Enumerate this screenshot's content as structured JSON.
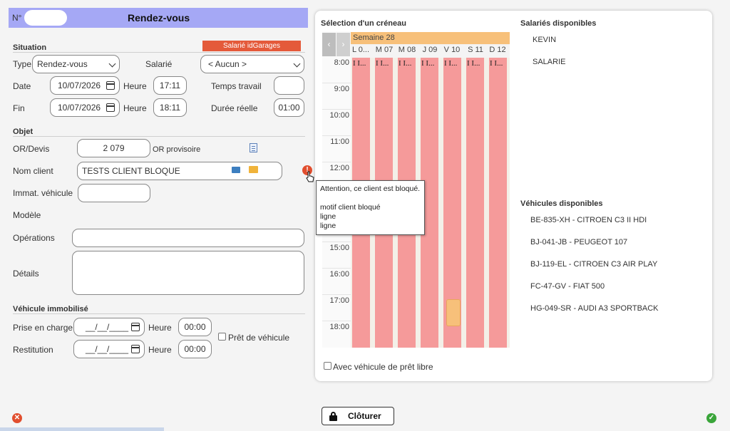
{
  "header": {
    "no_label": "N°",
    "title": "Rendez-vous",
    "header_color": "#a5a8f5"
  },
  "situation": {
    "section_title": "Situation",
    "badge": "Salarié idGarages",
    "badge_color": "#e45a3a",
    "type_label": "Type",
    "type_value": "Rendez-vous",
    "salarie_label": "Salarié",
    "salarie_value": "< Aucun >",
    "date_label": "Date",
    "date_value": "10/07/2026",
    "heure_label": "Heure",
    "date_time": "17:11",
    "temps_travail_label": "Temps travail",
    "temps_travail_value": "",
    "fin_label": "Fin",
    "fin_value": "10/07/2026",
    "fin_time": "18:11",
    "duree_label": "Durée réelle",
    "duree_value": "01:00"
  },
  "objet": {
    "section_title": "Objet",
    "or_label": "OR/Devis",
    "or_value": "2 079",
    "or_provisoire": "OR provisoire",
    "client_label": "Nom client",
    "client_value": "TESTS CLIENT BLOQUE",
    "immat_label": "Immat. véhicule",
    "immat_value": "",
    "modele_label": "Modèle",
    "operations_label": "Opérations",
    "details_label": "Détails"
  },
  "tooltip": {
    "line1": "Attention, ce client est bloqué.",
    "line2": "motif client bloqué",
    "line3": "ligne",
    "line4": "ligne"
  },
  "immobilise": {
    "section_title": "Véhicule immobilisé",
    "prise_label": "Prise en charge",
    "prise_date": "__/__/____",
    "heure_label": "Heure",
    "prise_time": "00:00",
    "pret_label": "Prêt de véhicule",
    "restitution_label": "Restitution",
    "restitution_date": "__/__/____",
    "restitution_time": "00:00"
  },
  "calendar": {
    "title": "Sélection d'un créneau",
    "week": "Semaine 28",
    "week_color": "#f7c07a",
    "day_color": "#f59a9a",
    "slot_color": "#f7c07a",
    "slot_text": "I I...",
    "days": [
      "L 0...",
      "M 07",
      "M 08",
      "J 09",
      "V 10",
      "S 11",
      "D 12"
    ],
    "hours": [
      "8:00",
      "9:00",
      "10:00",
      "11:00",
      "12:00",
      "15:00",
      "16:00",
      "17:00",
      "18:00"
    ],
    "pret_libre_label": "Avec véhicule de prêt libre"
  },
  "salaries": {
    "title": "Salariés disponibles",
    "items": [
      "KEVIN",
      "SALARIE"
    ]
  },
  "vehicules": {
    "title": "Véhicules disponibles",
    "items": [
      "BE-835-XH - CITROEN C3 II HDI",
      "BJ-041-JB - PEUGEOT 107",
      "BJ-119-EL - CITROEN C3 AIR PLAY",
      "FC-47-GV - FIAT 500",
      "HG-049-SR - AUDI A3 SPORTBACK"
    ]
  },
  "footer": {
    "cloturer": "Clôturer",
    "cancel_icon": "close-circle-icon",
    "ok_icon": "check-circle-icon"
  }
}
